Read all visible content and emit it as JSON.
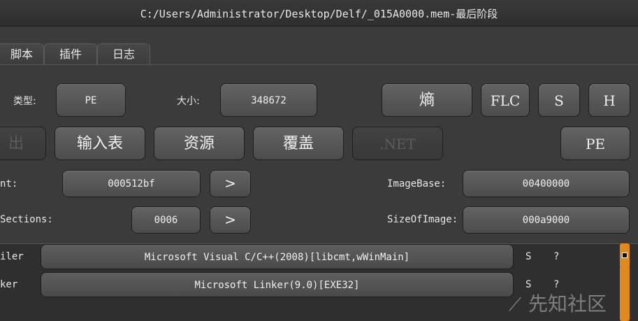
{
  "window": {
    "title": "C:/Users/Administrator/Desktop/Delf/_015A0000.mem-最后阶段"
  },
  "tabs": [
    "脚本",
    "插件",
    "日志"
  ],
  "row1": {
    "type_label": "类型:",
    "type_value": "PE",
    "size_label": "大小:",
    "size_value": "348672",
    "entropy_button": "熵",
    "flc_button": "FLC",
    "s_button": "S",
    "h_button": "H"
  },
  "row2": {
    "export_button": "出",
    "import_button": "输入表",
    "resource_button": "资源",
    "overlay_button": "覆盖",
    "net_button": ".NET",
    "pe_button": "PE"
  },
  "row3": {
    "entry_label": "nt:",
    "entry_value": "000512bf",
    "entry_arrow": ">",
    "imagebase_label": "ImageBase:",
    "imagebase_value": "00400000"
  },
  "row4": {
    "sections_label": "Sections:",
    "sections_value": "0006",
    "sections_arrow": ">",
    "sizeofimage_label": "SizeOfImage:",
    "sizeofimage_value": "000a9000"
  },
  "results": [
    {
      "type": "iler",
      "value": "Microsoft Visual C/C++(2008)[libcmt,wWinMain]",
      "s": "S",
      "q": "?"
    },
    {
      "type": "ker",
      "value": "Microsoft Linker(9.0)[EXE32]",
      "s": "S",
      "q": "?"
    }
  ],
  "watermark": "先知社区"
}
